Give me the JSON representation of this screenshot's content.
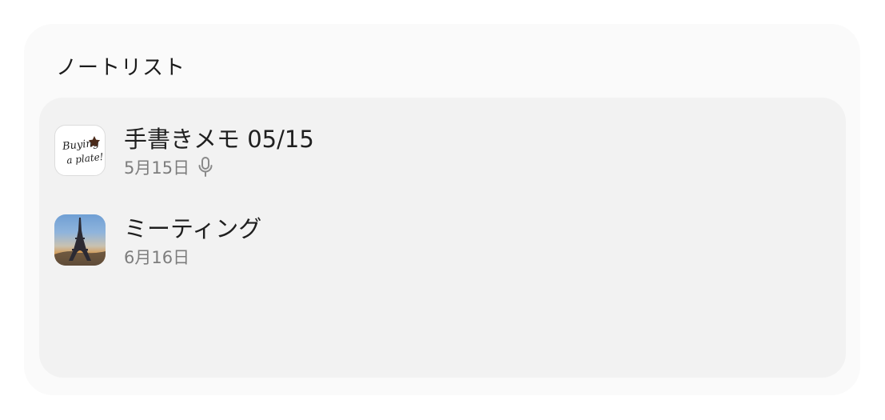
{
  "widget": {
    "title": "ノートリスト"
  },
  "notes": [
    {
      "title": "手書きメモ 05/15",
      "date": "5月15日",
      "thumbnail_icon": "handwriting-thumbnail",
      "thumbnail_text": "Buying a plate!",
      "has_voice_recording": true,
      "status_icon": "microphone-icon"
    },
    {
      "title": "ミーティング",
      "date": "6月16日",
      "thumbnail_icon": "eiffel-tower-photo-thumbnail",
      "has_voice_recording": false
    }
  ],
  "colors": {
    "widget_bg": "#fafafa",
    "list_bg": "#f2f2f2",
    "title_text": "#1f1f1f",
    "meta_text": "#7d7d7d"
  }
}
